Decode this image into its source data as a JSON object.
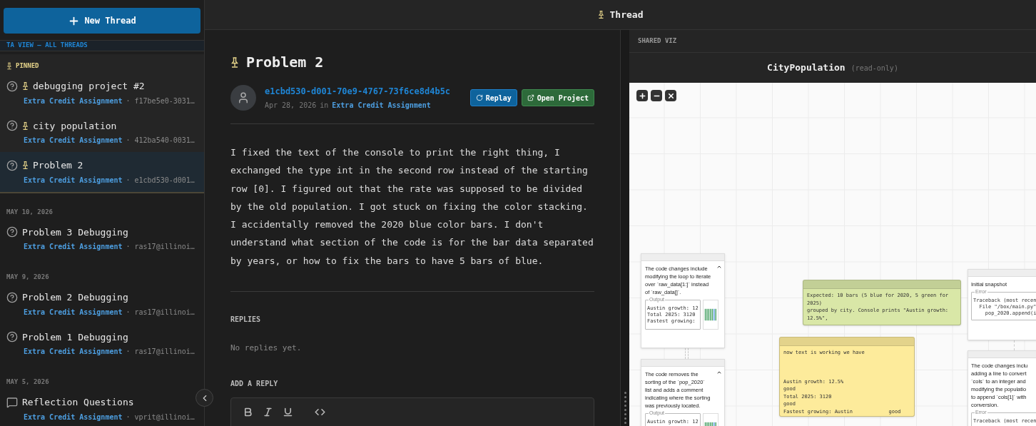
{
  "new_thread_button": "New Thread",
  "view_banner": "TA VIEW — ALL THREADS",
  "pinned": {
    "label": "PINNED",
    "threads": [
      {
        "title": "debugging project #2",
        "kind": "question",
        "pinned": true,
        "selected": false,
        "course": "Extra Credit Assignment",
        "meta": "· f17be5e0-3031…"
      },
      {
        "title": "city population",
        "kind": "question",
        "pinned": true,
        "selected": false,
        "course": "Extra Credit Assignment",
        "meta": "· 412ba540-0031…"
      },
      {
        "title": "Problem 2",
        "kind": "question",
        "pinned": true,
        "selected": true,
        "course": "Extra Credit Assignment",
        "meta": "· e1cbd530-d001…"
      }
    ]
  },
  "groups": [
    {
      "date": "MAY 10, 2026",
      "threads": [
        {
          "title": "Problem 3 Debugging",
          "kind": "question",
          "pinned": false,
          "selected": false,
          "course": "Extra Credit Assignment",
          "meta": "· ras17@illinoi…"
        }
      ]
    },
    {
      "date": "MAY 9, 2026",
      "threads": [
        {
          "title": "Problem 2 Debugging",
          "kind": "question",
          "pinned": false,
          "selected": false,
          "course": "Extra Credit Assignment",
          "meta": "· ras17@illinoi…"
        },
        {
          "title": "Problem 1 Debugging",
          "kind": "question",
          "pinned": false,
          "selected": false,
          "course": "Extra Credit Assignment",
          "meta": "· ras17@illinoi…"
        }
      ]
    },
    {
      "date": "MAY 5, 2026",
      "threads": [
        {
          "title": "Reflection Questions",
          "kind": "reflection",
          "pinned": false,
          "selected": false,
          "course": "Extra Credit Assignment",
          "meta": "· vprit@illinoi…"
        }
      ]
    }
  ],
  "header": {
    "title": "Thread"
  },
  "thread": {
    "title": "Problem 2",
    "pinned": true,
    "author": "e1cbd530-d001-70e9-4767-73f6ce8d4b5c",
    "date": "Apr 28, 2026",
    "in": "in",
    "course": "Extra Credit Assignment",
    "buttons": [
      {
        "label": "Replay",
        "kind": "replay"
      },
      {
        "label": "Open Project",
        "kind": "open"
      }
    ],
    "body": "I fixed the text of the console to print the right thing, I exchanged the type int in the second row instead of the starting row [0]. I figured out that the rate was supposed to be divided by the old population. I got stuck on fixing the color stacking. I accidentally removed the 2020 blue color bars. I don't understand what section of the code is for the bar data separated by years, or how to fix the bars to have 5 bars of blue.",
    "replies_label": "REPLIES",
    "replies_empty": "No replies yet.",
    "add_reply_label": "ADD A REPLY"
  },
  "viz": {
    "label": "SHARED VIZ",
    "title": "CityPopulation",
    "note": "(read-only)",
    "nodes": [
      {
        "kind": "step",
        "expanded": true,
        "lines": [
          "The code changes include",
          "modifying the loop to iterate",
          "over `raw_data[1:]` instead",
          "of `raw_data[]`."
        ],
        "box": {
          "label": "Output",
          "lines": [
            "Austin growth: 12",
            "Total 2025: 3120",
            "Fastest growing:"
          ]
        },
        "chart_thumbnail": true
      },
      {
        "kind": "note",
        "color": "#d9e7a7",
        "blocks": [
          [
            "Expected: 10 bars (5 blue for 2020, 5 green for",
            "2025)",
            "grouped by city. Console prints \"Austin growth:",
            "12.5%\","
          ]
        ]
      },
      {
        "kind": "step",
        "lines": [
          "Initial snapshot"
        ],
        "box": {
          "label": "Error",
          "lines": [
            "Traceback (most recen",
            "  File \"/box/main.py\"",
            "    pop_2020.append(i"
          ]
        },
        "chart_thumbnail": false
      },
      {
        "kind": "note",
        "color": "#fdeb9b",
        "blocks": [
          [
            "now text is working we have"
          ],
          [
            "Austin growth: 12.5%",
            "good",
            "Total 2025: 3120",
            "good",
            "Fastest growing: Austin            good"
          ]
        ]
      },
      {
        "kind": "step",
        "expanded": true,
        "lines": [
          "The code removes the",
          "sorting of the `pop_2020`",
          "list and adds a comment",
          "indicating where the sorting",
          "was previously located."
        ],
        "box": {
          "label": "Output",
          "lines": [
            "Austin growth: 12"
          ]
        },
        "chart_thumbnail": true
      },
      {
        "kind": "step",
        "lines": [
          "The code changes inclu",
          "adding a line to convert",
          "`cols` to an integer and",
          "modifying the populatio",
          "to append `cols[1]` with",
          "conversion."
        ],
        "box": {
          "label": "Error",
          "lines": [
            "Traceback (most recen"
          ]
        }
      }
    ]
  }
}
